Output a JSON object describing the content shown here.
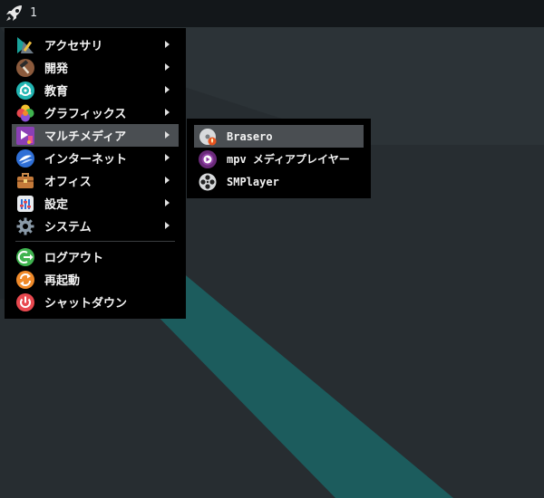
{
  "taskbar": {
    "launcher_icon": "rocket-icon",
    "workspace_label": "1"
  },
  "menu": {
    "categories": [
      {
        "label": "アクセサリ",
        "icon": "accessories-icon"
      },
      {
        "label": "開発",
        "icon": "hammer-icon"
      },
      {
        "label": "教育",
        "icon": "education-icon"
      },
      {
        "label": "グラフィックス",
        "icon": "graphics-icon"
      },
      {
        "label": "マルチメディア",
        "icon": "multimedia-icon"
      },
      {
        "label": "インターネット",
        "icon": "internet-icon"
      },
      {
        "label": "オフィス",
        "icon": "briefcase-icon"
      },
      {
        "label": "設定",
        "icon": "settings-icon"
      },
      {
        "label": "システム",
        "icon": "gear-icon"
      }
    ],
    "session": [
      {
        "label": "ログアウト",
        "icon": "logout-icon"
      },
      {
        "label": "再起動",
        "icon": "restart-icon"
      },
      {
        "label": "シャットダウン",
        "icon": "power-icon"
      }
    ]
  },
  "submenu": {
    "items": [
      {
        "label": "Brasero",
        "icon": "disc-burner-icon"
      },
      {
        "label": "mpv メディアプレイヤー",
        "icon": "play-icon"
      },
      {
        "label": "SMPlayer",
        "icon": "film-reel-icon"
      }
    ]
  },
  "colors": {
    "desktop": "#272d31",
    "stripe": "#1d5a5a",
    "menu_bg": "#000000",
    "highlight": "#4a4e52"
  }
}
